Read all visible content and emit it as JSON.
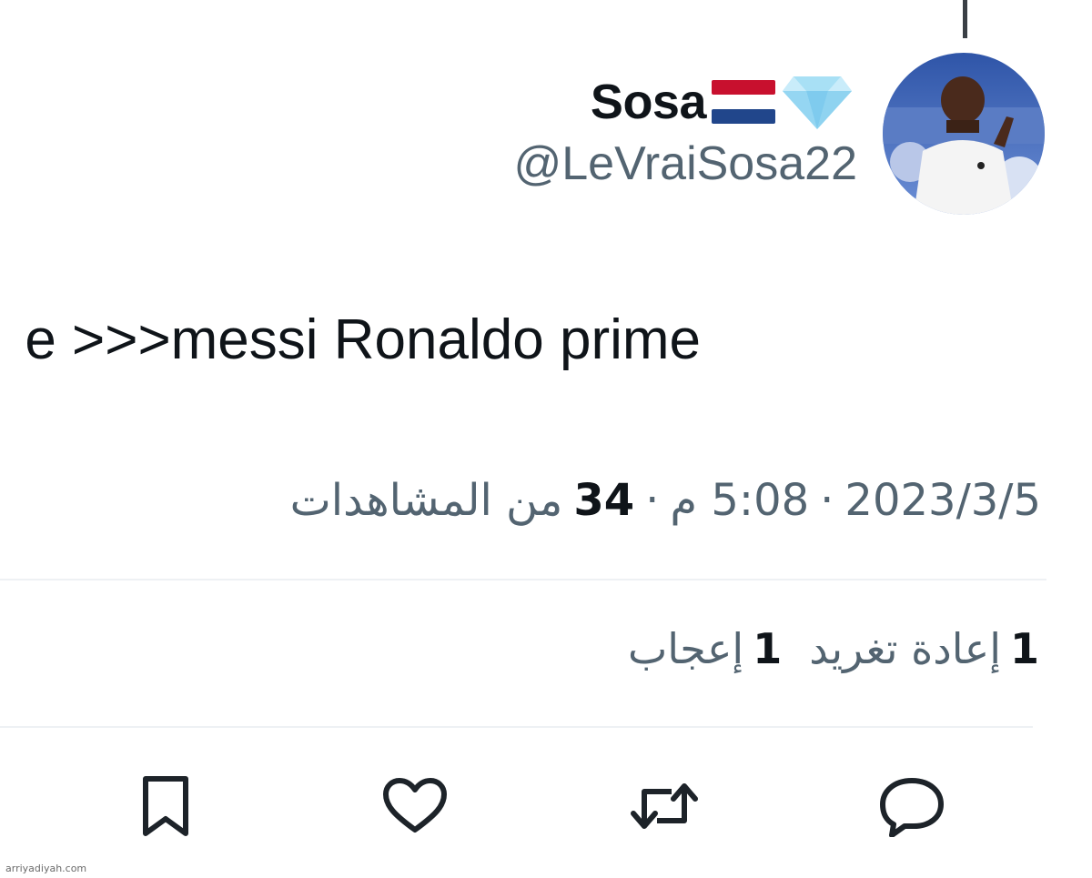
{
  "tweet": {
    "author": {
      "display_name": "Sosa",
      "handle": "@LeVraiSosa22",
      "flag_icon": "netherlands-flag-icon",
      "badge_icon": "diamond-icon"
    },
    "text": "e >>>messi Ronaldo prime",
    "meta": {
      "date": "2023/3/5",
      "separator": "·",
      "time": "5:08 م",
      "views_count": "34",
      "views_label": "من المشاهدات"
    },
    "stats": {
      "retweets_count": "1",
      "retweets_label": "إعادة تغريد",
      "likes_count": "1",
      "likes_label": "إعجاب"
    },
    "actions": [
      {
        "name": "reply",
        "icon": "reply-icon"
      },
      {
        "name": "retweet",
        "icon": "retweet-icon"
      },
      {
        "name": "like",
        "icon": "heart-icon"
      },
      {
        "name": "bookmark",
        "icon": "bookmark-icon"
      }
    ]
  },
  "watermark": "arriyadiyah.com",
  "colors": {
    "text_primary": "#0f1419",
    "text_secondary": "#536471",
    "divider": "#eef1f4",
    "diamond": "#8fd3f0",
    "flag_red": "#c8102e",
    "flag_white": "#ffffff",
    "flag_blue": "#21468b"
  }
}
